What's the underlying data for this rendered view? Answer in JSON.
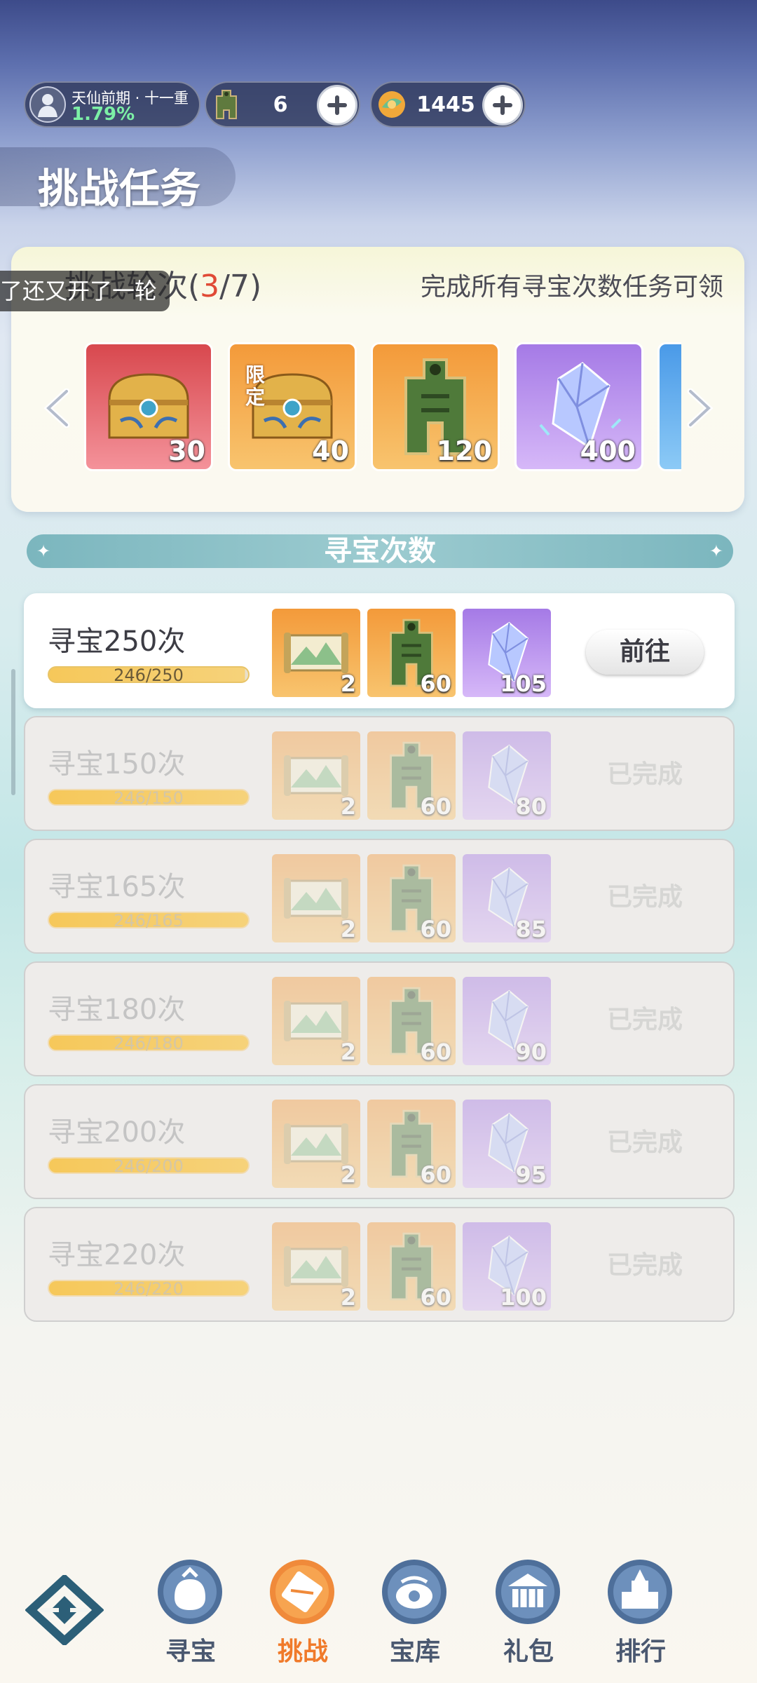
{
  "top_bar": {
    "realm": {
      "stage": "天仙前期 · 十一重",
      "percent": "1.79%"
    },
    "resources": [
      {
        "icon": "token-icon",
        "value": "6"
      },
      {
        "icon": "jade-coin-icon",
        "value": "1445"
      }
    ]
  },
  "page_title": "挑战任务",
  "rounds": {
    "label_prefix": "挑战轮次(",
    "current": "3",
    "separator": "/",
    "total": "7",
    "label_suffix": ")",
    "note": "完成所有寻宝次数任务可领",
    "toast": "了还又开了一轮",
    "rewards": [
      {
        "icon": "treasure-chest-icon",
        "count": "30",
        "tag": ""
      },
      {
        "icon": "limited-chest-icon",
        "count": "40",
        "tag": "限定"
      },
      {
        "icon": "token-icon",
        "count": "120",
        "tag": ""
      },
      {
        "icon": "crystal-icon",
        "count": "400",
        "tag": ""
      }
    ]
  },
  "section_title": "寻宝次数",
  "tasks": [
    {
      "name": "寻宝250次",
      "progress": "246/250",
      "progress_fraction": 0.984,
      "rewards": [
        "2",
        "60",
        "105"
      ],
      "action": "前往",
      "state": "active"
    },
    {
      "name": "寻宝150次",
      "progress": "246/150",
      "progress_fraction": 1,
      "rewards": [
        "2",
        "60",
        "80"
      ],
      "action": "已完成",
      "state": "done"
    },
    {
      "name": "寻宝165次",
      "progress": "246/165",
      "progress_fraction": 1,
      "rewards": [
        "2",
        "60",
        "85"
      ],
      "action": "已完成",
      "state": "done"
    },
    {
      "name": "寻宝180次",
      "progress": "246/180",
      "progress_fraction": 1,
      "rewards": [
        "2",
        "60",
        "90"
      ],
      "action": "已完成",
      "state": "done"
    },
    {
      "name": "寻宝200次",
      "progress": "246/200",
      "progress_fraction": 1,
      "rewards": [
        "2",
        "60",
        "95"
      ],
      "action": "已完成",
      "state": "done"
    },
    {
      "name": "寻宝220次",
      "progress": "246/220",
      "progress_fraction": 1,
      "rewards": [
        "2",
        "60",
        "100"
      ],
      "action": "已完成",
      "state": "done"
    }
  ],
  "nav": [
    {
      "label": "寻宝",
      "icon": "treasure-bag-icon"
    },
    {
      "label": "挑战",
      "icon": "scroll-icon",
      "active": true
    },
    {
      "label": "宝库",
      "icon": "vault-icon"
    },
    {
      "label": "礼包",
      "icon": "gift-pavilion-icon"
    },
    {
      "label": "排行",
      "icon": "ranking-tower-icon"
    }
  ],
  "colors": {
    "accent": "#f07a2a",
    "round_current": "#e04a36",
    "progress": "#f6d27a"
  }
}
